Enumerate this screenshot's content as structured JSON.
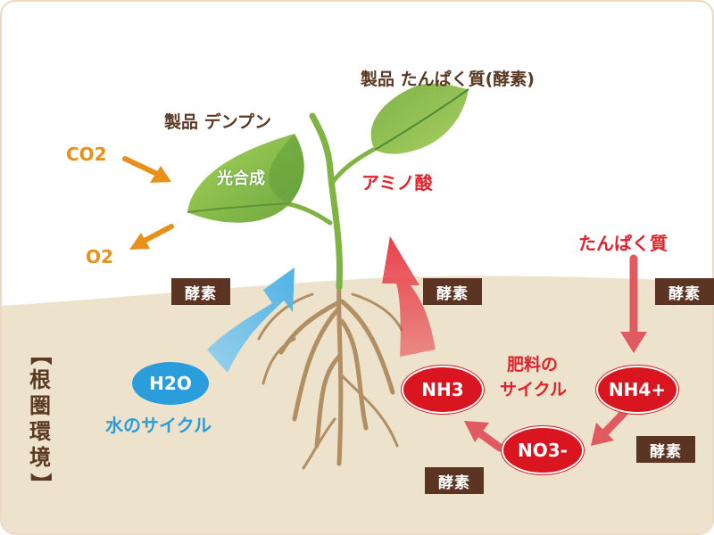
{
  "products": {
    "starch": "製品 デンプン",
    "protein": "製品 たんぱく質(酵素)"
  },
  "photosynthesis": "光合成",
  "co2": "CO2",
  "o2": "O2",
  "amino_acid": "アミノ酸",
  "protein_input": "たんぱく質",
  "enzyme_label": "酵素",
  "h2o": "H2O",
  "water_cycle": "水のサイクル",
  "nh3": "NH3",
  "nh4": "NH4+",
  "no3": "NO3-",
  "fertilizer_cycle": {
    "line1": "肥料の",
    "line2": "サイクル"
  },
  "rhizosphere": "【根圏環境】",
  "colors": {
    "soil": "#ede2cc",
    "sky": "#ffffff",
    "nitrogen_red": "#d9151f",
    "water_blue": "#2a9edc",
    "co2_orange": "#e8901a",
    "enzyme_brown": "#5b3424",
    "leaf_green": "#8cc04a",
    "leaf_dark": "#4e8f3a"
  },
  "icons": [
    "co2-in-arrow",
    "o2-out-arrow",
    "water-up-arrow",
    "amino-up-arrow",
    "protein-down-arrow",
    "nh4-to-no3-arrow",
    "no3-to-nh3-arrow"
  ]
}
